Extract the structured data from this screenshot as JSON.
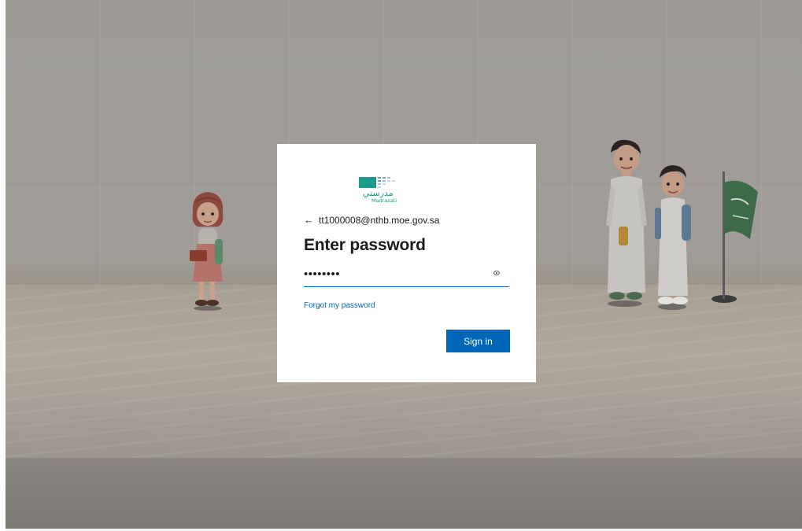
{
  "login": {
    "logo_text_arabic": "مدرستي",
    "logo_text_latin": "Madrasati",
    "back_arrow": "←",
    "email": "tt1000008@nthb.moe.gov.sa",
    "title": "Enter password",
    "password_value": "••••••••",
    "forgot_label": "Forgot my password",
    "signin_label": "Sign in"
  },
  "icons": {
    "reveal": "eye-icon",
    "back": "back-arrow-icon"
  },
  "colors": {
    "accent": "#0067b8",
    "logo_teal": "#1a9a8a",
    "card": "#ffffff"
  }
}
